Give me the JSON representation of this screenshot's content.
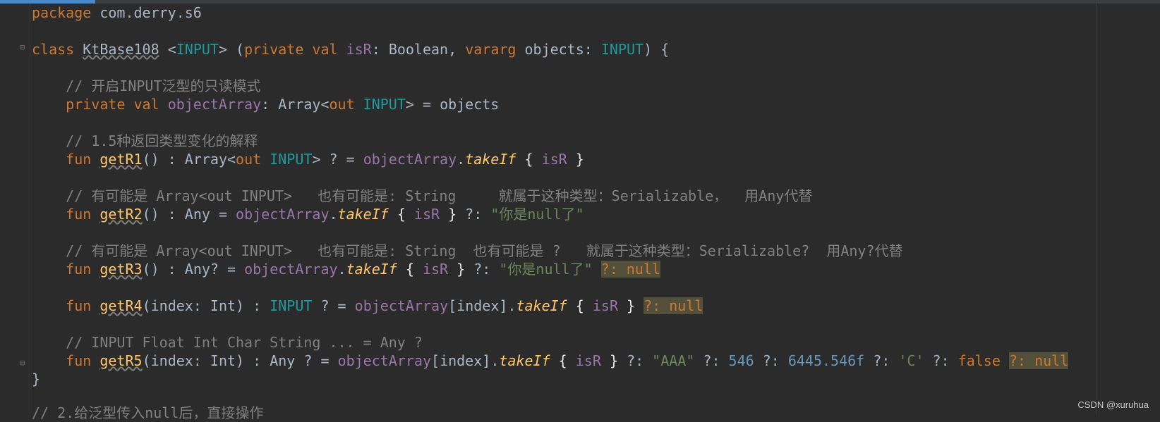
{
  "editor": {
    "package_kw": "package",
    "package_name": "com.derry.s6",
    "class_name": "KtBase108",
    "type_param": "INPUT",
    "kw_class": "class",
    "kw_private": "private",
    "kw_val": "val",
    "kw_vararg": "vararg",
    "kw_fun": "fun",
    "kw_out": "out",
    "param_isR": "isR",
    "type_boolean": "Boolean",
    "param_objects": "objects",
    "comment1": "// 开启INPUT泛型的只读模式",
    "prop_objectArray": "objectArray",
    "type_array": "Array",
    "comment2": "// 1.5种返回类型变化的解释",
    "fn_getR1": "getR1",
    "fn_takeIf": "takeIf",
    "comment3": "// 有可能是 Array<out INPUT>   也有可能是: String     就属于这种类型：Serializable，  用Any代替",
    "fn_getR2": "getR2",
    "type_any": "Any",
    "str_null": "\"你是null了\"",
    "comment4": "// 有可能是 Array<out INPUT>   也有可能是: String  也有可能是 ?   就属于这种类型：Serializable?  用Any?代替",
    "fn_getR3": "getR3",
    "elvis_null": "?: null",
    "fn_getR4": "getR4",
    "param_index": "index",
    "type_int": "Int",
    "comment5": "// INPUT Float Int Char String ... = Any ?",
    "fn_getR5": "getR5",
    "str_aaa": "\"AAA\"",
    "num_546": "546",
    "num_float": "6445.546f",
    "char_c": "'C'",
    "kw_false": "false",
    "cut_line": "// 2.给泛型传入null后，直接操作"
  },
  "watermark": "CSDN @xuruhua",
  "colors": {
    "background": "#2b2b2b",
    "keyword": "#cc7832",
    "function": "#ffc66d",
    "property": "#9876aa",
    "type_param": "#20999d",
    "string": "#6a8759",
    "number": "#6897bb",
    "comment": "#808080"
  }
}
